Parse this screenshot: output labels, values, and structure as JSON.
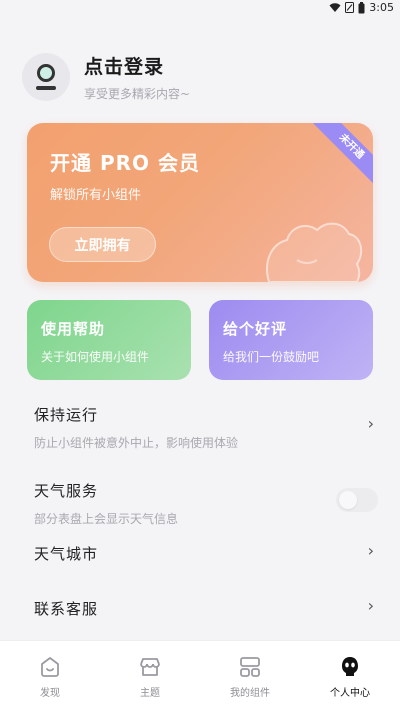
{
  "status_bar": {
    "time": "3:05"
  },
  "profile": {
    "title": "点击登录",
    "subtitle": "享受更多精彩内容~"
  },
  "pro_card": {
    "title": "开通 PRO 会员",
    "subtitle": "解锁所有小组件",
    "button": "立即拥有",
    "ribbon": "未开通"
  },
  "cards": {
    "help": {
      "title": "使用帮助",
      "subtitle": "关于如何使用小组件"
    },
    "rate": {
      "title": "给个好评",
      "subtitle": "给我们一份鼓励吧"
    }
  },
  "settings": {
    "keep_running": {
      "title": "保持运行",
      "subtitle": "防止小组件被意外中止，影响使用体验"
    },
    "weather_service": {
      "title": "天气服务",
      "subtitle": "部分表盘上会显示天气信息",
      "enabled": false
    },
    "weather_city": {
      "title": "天气城市"
    },
    "contact": {
      "title": "联系客服"
    }
  },
  "tabbar": [
    {
      "label": "发现",
      "icon": "discover-icon",
      "active": false
    },
    {
      "label": "主题",
      "icon": "theme-shop-icon",
      "active": false
    },
    {
      "label": "我的组件",
      "icon": "widgets-grid-icon",
      "active": false
    },
    {
      "label": "个人中心",
      "icon": "profile-face-icon",
      "active": true
    }
  ],
  "colors": {
    "pro_gradient_start": "#f3a06f",
    "help_green": "#7ed58c",
    "rate_purple": "#9d8bf0",
    "ribbon_purple": "#9b8cf5"
  }
}
